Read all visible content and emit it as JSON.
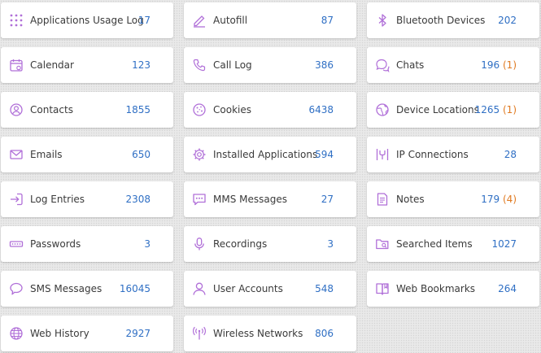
{
  "accent_color": "#b06fd8",
  "count_color": "#2f6fc4",
  "extra_color": "#e07a21",
  "categories": [
    {
      "label": "Applications Usage Log",
      "count": "17",
      "extra": "",
      "icon": "grid-dots-icon"
    },
    {
      "label": "Autofill",
      "count": "87",
      "extra": "",
      "icon": "pen-icon"
    },
    {
      "label": "Bluetooth Devices",
      "count": "202",
      "extra": "",
      "icon": "bluetooth-icon"
    },
    {
      "label": "Calendar",
      "count": "123",
      "extra": "",
      "icon": "calendar-icon"
    },
    {
      "label": "Call Log",
      "count": "386",
      "extra": "",
      "icon": "phone-icon"
    },
    {
      "label": "Chats",
      "count": "196",
      "extra": "(1)",
      "icon": "chat-bubbles-icon"
    },
    {
      "label": "Contacts",
      "count": "1855",
      "extra": "",
      "icon": "contact-icon"
    },
    {
      "label": "Cookies",
      "count": "6438",
      "extra": "",
      "icon": "cookie-icon"
    },
    {
      "label": "Device Locations",
      "count": "1265",
      "extra": "(1)",
      "icon": "globe-location-icon"
    },
    {
      "label": "Emails",
      "count": "650",
      "extra": "",
      "icon": "envelope-icon"
    },
    {
      "label": "Installed Applications",
      "count": "594",
      "extra": "",
      "icon": "gear-app-icon"
    },
    {
      "label": "IP Connections",
      "count": "28",
      "extra": "",
      "icon": "network-icon"
    },
    {
      "label": "Log Entries",
      "count": "2308",
      "extra": "",
      "icon": "login-arrow-icon"
    },
    {
      "label": "MMS Messages",
      "count": "27",
      "extra": "",
      "icon": "message-dots-icon"
    },
    {
      "label": "Notes",
      "count": "179",
      "extra": "(4)",
      "icon": "note-icon"
    },
    {
      "label": "Passwords",
      "count": "3",
      "extra": "",
      "icon": "password-icon"
    },
    {
      "label": "Recordings",
      "count": "3",
      "extra": "",
      "icon": "microphone-icon"
    },
    {
      "label": "Searched Items",
      "count": "1027",
      "extra": "",
      "icon": "folder-search-icon"
    },
    {
      "label": "SMS Messages",
      "count": "16045",
      "extra": "",
      "icon": "speech-bubble-icon"
    },
    {
      "label": "User Accounts",
      "count": "548",
      "extra": "",
      "icon": "user-icon"
    },
    {
      "label": "Web Bookmarks",
      "count": "264",
      "extra": "",
      "icon": "book-icon"
    },
    {
      "label": "Web History",
      "count": "2927",
      "extra": "",
      "icon": "globe-icon"
    },
    {
      "label": "Wireless Networks",
      "count": "806",
      "extra": "",
      "icon": "antenna-icon"
    }
  ]
}
